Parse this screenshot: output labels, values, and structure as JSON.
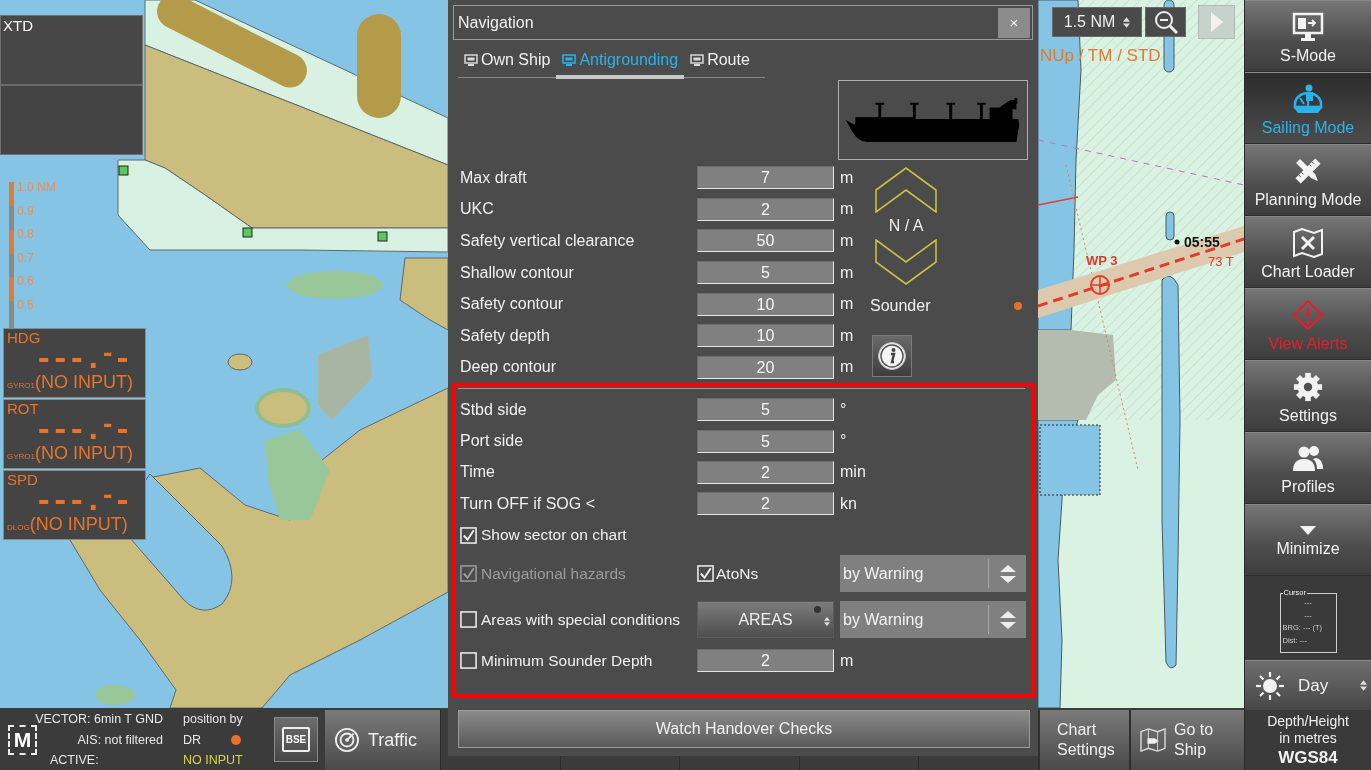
{
  "chart": {
    "mode": "NUp / TM / STD",
    "range": "1.5 NM",
    "scale_labels": [
      "1.0 NM",
      "0.9",
      "0.8",
      "0.7",
      "0.6",
      "0.5"
    ],
    "route": {
      "waypoint": "WP 3",
      "time": "05:55",
      "course": "73 T"
    }
  },
  "xtd_panel": {
    "title": "XTD"
  },
  "sensors": [
    {
      "label": "HDG",
      "value": "---.$^{-}$-",
      "source": "GYRO1",
      "status": "(NO INPUT)"
    },
    {
      "label": "ROT",
      "value": "---.$^{-}$-",
      "source": "GYRO1",
      "status": "(NO INPUT)"
    },
    {
      "label": "SPD",
      "value": "---.$^{-}$-",
      "source": "DLOG",
      "status": "(NO INPUT)"
    }
  ],
  "navigation": {
    "title": "Navigation",
    "close": "×",
    "tabs": [
      {
        "label": "Own Ship",
        "selected": false
      },
      {
        "label": "Antigrounding",
        "selected": true
      },
      {
        "label": "Route",
        "selected": false
      }
    ],
    "fields": [
      {
        "label": "Max draft",
        "value": "7",
        "unit": "m"
      },
      {
        "label": "UKC",
        "value": "2",
        "unit": "m"
      },
      {
        "label": "Safety vertical clearance",
        "value": "50",
        "unit": "m"
      },
      {
        "label": "Shallow contour",
        "value": "5",
        "unit": "m"
      },
      {
        "label": "Safety contour",
        "value": "10",
        "unit": "m"
      },
      {
        "label": "Safety depth",
        "value": "10",
        "unit": "m"
      },
      {
        "label": "Deep contour",
        "value": "20",
        "unit": "m"
      }
    ],
    "draft_status": "N / A",
    "sounder": "Sounder",
    "sector_fields": [
      {
        "label": "Stbd side",
        "value": "5",
        "unit": "°"
      },
      {
        "label": "Port side",
        "value": "5",
        "unit": "°"
      },
      {
        "label": "Time",
        "value": "2",
        "unit": "min"
      },
      {
        "label": "Turn OFF if SOG <",
        "value": "2",
        "unit": "kn"
      }
    ],
    "options": [
      {
        "kind": "check",
        "label": "Show sector on chart",
        "checked": true,
        "disabled": false
      },
      {
        "kind": "check_select",
        "label": "Navigational hazards",
        "checked": true,
        "disabled": true,
        "second": {
          "label": "AtoNs",
          "checked": true,
          "disabled": false
        },
        "select": "by Warning"
      },
      {
        "kind": "button_select",
        "label": "Areas with special conditions",
        "checked": false,
        "disabled": false,
        "button": "AREAS",
        "select": "by Warning"
      },
      {
        "kind": "value",
        "label": "Minimum Sounder Depth",
        "checked": false,
        "disabled": false,
        "value": "2",
        "unit": "m"
      }
    ],
    "handover_button": "Watch Handover Checks"
  },
  "bottom_bar": {
    "logo": "M",
    "vector": "VECTOR: 6min T GND",
    "ais": "AIS: not filtered",
    "active": "ACTIVE:",
    "position_label": "position by",
    "position_source": "DR",
    "position_status": "NO INPUT",
    "bse": "BSE",
    "traffic": "Traffic",
    "chart_settings": "Chart Settings",
    "go_to_ship": "Go to Ship"
  },
  "sidebar": {
    "items": [
      {
        "label": "S-Mode",
        "selected": false,
        "alert": false
      },
      {
        "label": "Sailing Mode",
        "selected": true,
        "alert": false
      },
      {
        "label": "Planning Mode",
        "selected": false,
        "alert": false
      },
      {
        "label": "Chart Loader",
        "selected": false,
        "alert": false
      },
      {
        "label": "View Alerts",
        "selected": false,
        "alert": true
      },
      {
        "label": "Settings",
        "selected": false,
        "alert": false
      },
      {
        "label": "Profiles",
        "selected": false,
        "alert": false
      },
      {
        "label": "Minimize",
        "selected": false,
        "alert": false
      }
    ],
    "cursor": {
      "legend": "Cursor",
      "lines": [
        "---",
        "---",
        "BRG: --- (T)",
        "Dist: ---"
      ]
    },
    "day": "Day",
    "units": "Depth/Height in metres",
    "datum": "WGS84"
  }
}
